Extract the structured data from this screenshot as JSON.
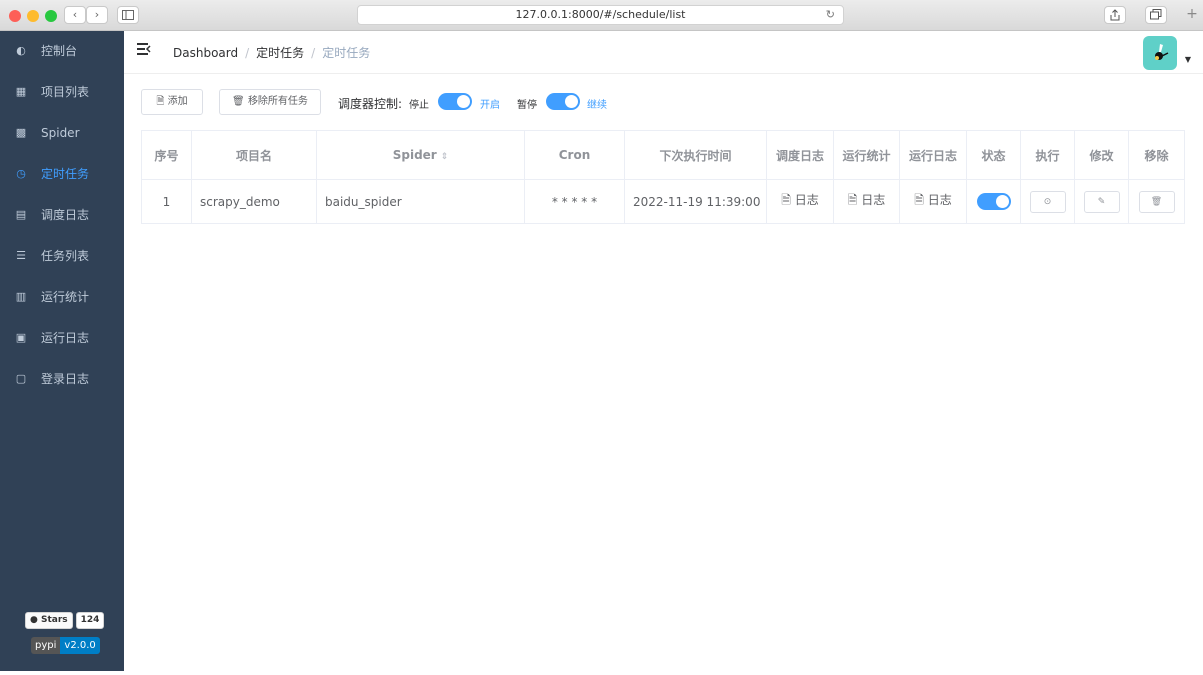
{
  "browser": {
    "url": "127.0.0.1:8000/#/schedule/list",
    "reload_icon": "reload-icon",
    "back_label": "‹",
    "forward_label": "›"
  },
  "sidebar": {
    "items": [
      {
        "label": "控制台",
        "icon": "dashboard-icon",
        "glyph": "◐"
      },
      {
        "label": "项目列表",
        "icon": "grid-icon",
        "glyph": "▦"
      },
      {
        "label": "Spider",
        "icon": "table-icon",
        "glyph": "▩"
      },
      {
        "label": "定时任务",
        "icon": "clock-icon",
        "glyph": "◷"
      },
      {
        "label": "调度日志",
        "icon": "log-icon",
        "glyph": "▤"
      },
      {
        "label": "任务列表",
        "icon": "list-icon",
        "glyph": "☰"
      },
      {
        "label": "运行统计",
        "icon": "chart-icon",
        "glyph": "▥"
      },
      {
        "label": "运行日志",
        "icon": "document-icon",
        "glyph": "▣"
      },
      {
        "label": "登录日志",
        "icon": "login-log-icon",
        "glyph": "▢"
      }
    ],
    "active_index": 3,
    "stars_label": "Stars",
    "stars_count": "124",
    "pypi_label": "pypi",
    "pypi_version": "v2.0.0"
  },
  "header": {
    "breadcrumbs": [
      "Dashboard",
      "定时任务",
      "定时任务"
    ],
    "separator": "/"
  },
  "toolbar": {
    "add_label": "添加",
    "remove_all_label": "移除所有任务",
    "scheduler_control_label": "调度器控制:",
    "stop_label": "停止",
    "start_label": "开启",
    "pause_label": "暂停",
    "resume_label": "继续"
  },
  "table": {
    "columns": [
      "序号",
      "项目名",
      "Spider",
      "Cron",
      "下次执行时间",
      "调度日志",
      "运行统计",
      "运行日志",
      "状态",
      "执行",
      "修改",
      "移除"
    ],
    "rows": [
      {
        "index": "1",
        "project": "scrapy_demo",
        "spider": "baidu_spider",
        "cron": "* * * * *",
        "next_run": "2022-11-19 11:39:00",
        "schedule_log": "日志",
        "run_stats": "日志",
        "run_log": "日志",
        "status_on": true
      }
    ]
  },
  "colors": {
    "sidebar_bg": "#304156",
    "accent": "#409eff"
  }
}
